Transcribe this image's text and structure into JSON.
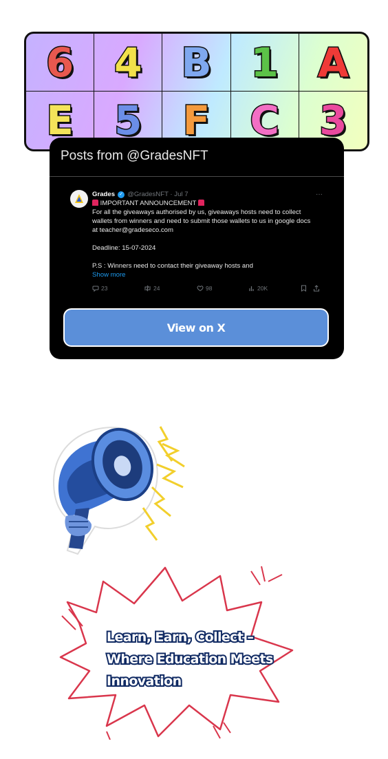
{
  "tiles": [
    {
      "char": "6",
      "color": "#e8584f"
    },
    {
      "char": "4",
      "color": "#f2e14a"
    },
    {
      "char": "B",
      "color": "#7fa8ef"
    },
    {
      "char": "1",
      "color": "#5cc248"
    },
    {
      "char": "A",
      "color": "#ef3a37"
    },
    {
      "char": "E",
      "color": "#f4e45a"
    },
    {
      "char": "5",
      "color": "#6b8ee8"
    },
    {
      "char": "F",
      "color": "#f49a3d"
    },
    {
      "char": "C",
      "color": "#f26fc4"
    },
    {
      "char": "3",
      "color": "#ea4a9e"
    }
  ],
  "embed": {
    "title": "Posts from @GradesNFT",
    "tweet": {
      "name": "Grades",
      "handle": "@GradesNFT · Jul 7",
      "more": "···",
      "headline": "IMPORTANT ANNOUNCEMENT",
      "lines": [
        "For all the giveaways authorised by us, giveaways hosts need to collect",
        "wallets from winners and need to submit those wallets to us in google docs",
        "at teacher@gradeseco.com"
      ],
      "deadline": "Deadline: 15-07-2024",
      "ps": "P.S : Winners need to contact their giveaway hosts and",
      "show_more": "Show more",
      "replies": "23",
      "reposts": "24",
      "likes": "98",
      "views": "20K"
    },
    "button_label": "View on X"
  },
  "slogan": {
    "line1": "Learn, Earn, Collect –",
    "line2": "Where Education Meets",
    "line3": "Innovation"
  },
  "colors": {
    "card_bg": "#000000",
    "button_bg": "#5b8fd9",
    "burst_outline": "#d9364c",
    "slogan_stroke": "#102a63",
    "megaphone": "#3f73d2",
    "lightning": "#f2cf2c"
  }
}
